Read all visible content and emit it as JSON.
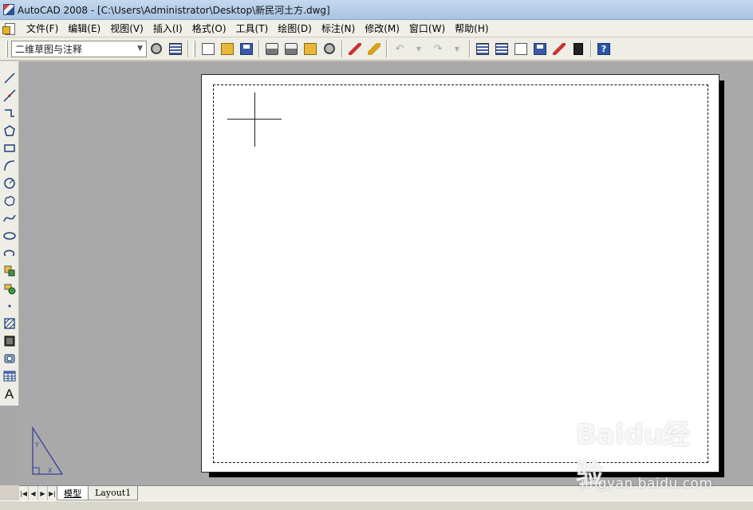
{
  "window": {
    "title": "AutoCAD 2008 - [C:\\Users\\Administrator\\Desktop\\新民河土方.dwg]"
  },
  "menubar": {
    "items": [
      "文件(F)",
      "编辑(E)",
      "视图(V)",
      "插入(I)",
      "格式(O)",
      "工具(T)",
      "绘图(D)",
      "标注(N)",
      "修改(M)",
      "窗口(W)",
      "帮助(H)"
    ]
  },
  "toolbar": {
    "workspace_value": "二维草图与注释",
    "buttons": [
      "gear-icon",
      "workspace-icon",
      "new-icon",
      "open-icon",
      "save-icon",
      "print-icon",
      "preview-icon",
      "publish-icon",
      "3d-dwf-icon",
      "match-properties-icon",
      "block-editor-icon",
      "undo-icon",
      "redo-icon",
      "properties-icon",
      "design-center-icon",
      "tool-palettes-icon",
      "sheet-set-icon",
      "markup-icon",
      "calculator-icon",
      "help-icon"
    ],
    "help_label": "?"
  },
  "draw_toolbar": {
    "text_tool_label": "A",
    "tools": [
      "line",
      "construction-line",
      "polyline",
      "polygon",
      "rectangle",
      "arc",
      "circle",
      "revision-cloud",
      "spline",
      "ellipse",
      "ellipse-arc",
      "insert-block",
      "make-block",
      "point",
      "hatch",
      "gradient",
      "region",
      "table",
      "multiline-text"
    ]
  },
  "layout_tabs": {
    "tabs": [
      "模型",
      "Layout1"
    ],
    "active": "模型"
  },
  "watermark": {
    "logo": "Baidu经验",
    "url": "jingyan.baidu.com"
  }
}
